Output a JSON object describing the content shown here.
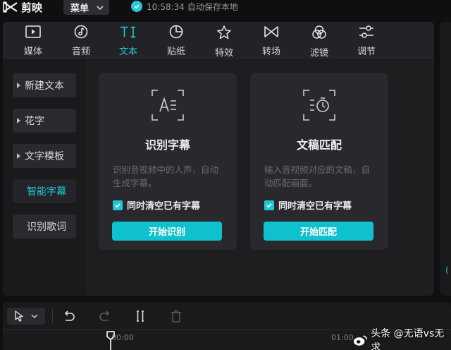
{
  "app": {
    "name": "剪映",
    "menu_label": "菜单",
    "save_status": "10:58:34 自动保存本地"
  },
  "toolbar": {
    "active": "文本",
    "items": [
      {
        "label": "媒体",
        "icon": "media-icon"
      },
      {
        "label": "音频",
        "icon": "audio-icon"
      },
      {
        "label": "文本",
        "icon": "text-icon"
      },
      {
        "label": "贴纸",
        "icon": "sticker-icon"
      },
      {
        "label": "特效",
        "icon": "effects-icon"
      },
      {
        "label": "转场",
        "icon": "transition-icon"
      },
      {
        "label": "滤镜",
        "icon": "filter-icon"
      },
      {
        "label": "调节",
        "icon": "adjust-icon"
      }
    ]
  },
  "sidebar": {
    "items": [
      {
        "label": "新建文本",
        "expandable": true
      },
      {
        "label": "花字",
        "expandable": true
      },
      {
        "label": "文字模板",
        "expandable": true
      },
      {
        "label": "智能字幕",
        "expandable": false,
        "active": true
      },
      {
        "label": "识别歌词",
        "expandable": false
      }
    ]
  },
  "cards": [
    {
      "title": "识别字幕",
      "description": "识别音视频中的人声，自动生成字幕。",
      "checkbox_label": "同时清空已有字幕",
      "checked": true,
      "button_label": "开始识别",
      "icon": "recognize-subtitle-icon"
    },
    {
      "title": "文稿匹配",
      "description": "输入音视频对应的文稿，自动匹配画面。",
      "checkbox_label": "同时清空已有字幕",
      "checked": true,
      "button_label": "开始匹配",
      "icon": "script-match-icon"
    }
  ],
  "timeline": {
    "time_start": "00:00",
    "time_mark": "01:00",
    "tools": [
      "select-icon",
      "undo-icon",
      "redo-icon",
      "split-icon",
      "delete-icon"
    ]
  },
  "watermark": "头条 @无语vs无求",
  "colors": {
    "accent": "#22c6d2",
    "button": "#0fc1cf",
    "background": "#0f0f11",
    "panel": "#1a1a1d",
    "card": "#29292d"
  }
}
